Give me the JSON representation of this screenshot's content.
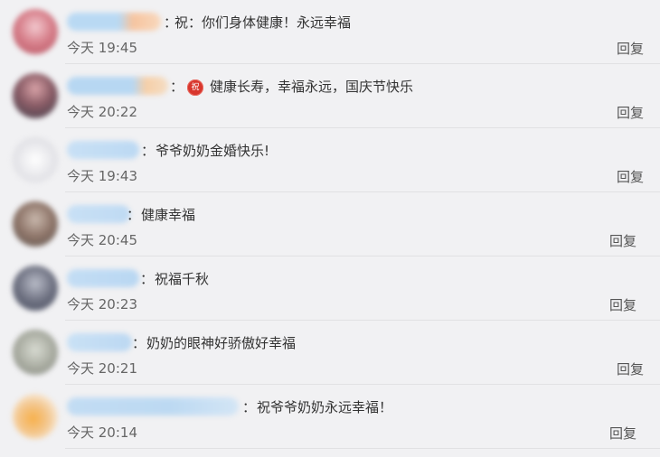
{
  "reply_label": "回复",
  "comments": [
    {
      "prefix": "祝：",
      "text": "你们身体健康！永远幸福",
      "time": "今天 19:45"
    },
    {
      "badge": "祝",
      "text": "健康长寿，幸福永远，国庆节快乐",
      "time": "今天 20:22"
    },
    {
      "text": "爷爷奶奶金婚快乐!",
      "time": "今天 19:43"
    },
    {
      "text": "健康幸福",
      "time": "今天 20:45"
    },
    {
      "text": "祝福千秋",
      "time": "今天 20:23"
    },
    {
      "text": "奶奶的眼神好骄傲好幸福",
      "time": "今天 20:21"
    },
    {
      "text": "祝爷爷奶奶永远幸福！",
      "time": "今天 20:14"
    }
  ]
}
